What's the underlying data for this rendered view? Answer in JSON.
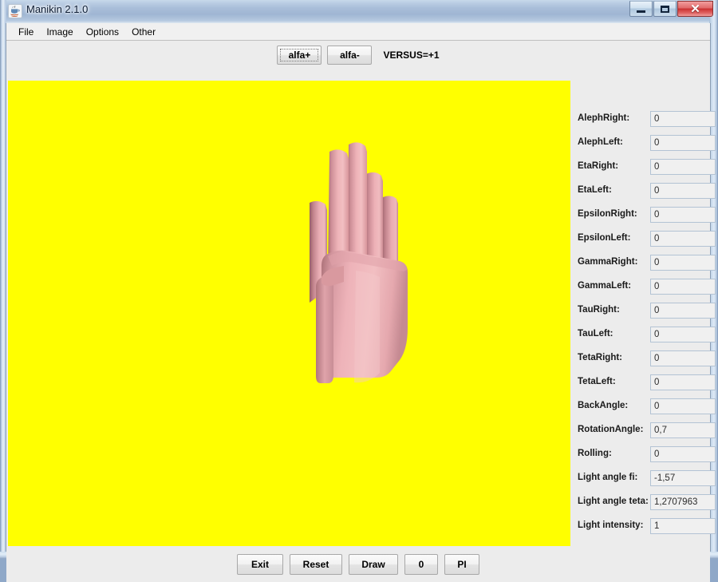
{
  "window": {
    "title": "Manikin 2.1.0",
    "icon": "java-coffee-cup-icon",
    "minimize_label": "Minimize",
    "maximize_label": "Maximize",
    "close_label": "✕"
  },
  "menu": {
    "items": [
      {
        "label": "File"
      },
      {
        "label": "Image"
      },
      {
        "label": "Options"
      },
      {
        "label": "Other"
      }
    ]
  },
  "toolbar": {
    "alfa_plus_label": "alfa+",
    "alfa_minus_label": "alfa-",
    "versus_label": "VERSUS=+1"
  },
  "canvas": {
    "background_color": "#ffff00",
    "object": "right-hand-3d-render",
    "skin_color": "#e8a2a8",
    "skin_highlight_color": "#f4c3c6",
    "skin_shadow_color": "#9e6268"
  },
  "parameters": [
    {
      "label": "AlephRight:",
      "value": "0"
    },
    {
      "label": "AlephLeft:",
      "value": "0"
    },
    {
      "label": "EtaRight:",
      "value": "0"
    },
    {
      "label": "EtaLeft:",
      "value": "0"
    },
    {
      "label": "EpsilonRight:",
      "value": "0"
    },
    {
      "label": "EpsilonLeft:",
      "value": "0"
    },
    {
      "label": "GammaRight:",
      "value": "0"
    },
    {
      "label": "GammaLeft:",
      "value": "0"
    },
    {
      "label": "TauRight:",
      "value": "0"
    },
    {
      "label": "TauLeft:",
      "value": "0"
    },
    {
      "label": "TetaRight:",
      "value": "0"
    },
    {
      "label": "TetaLeft:",
      "value": "0"
    },
    {
      "label": "BackAngle:",
      "value": "0"
    },
    {
      "label": "RotationAngle:",
      "value": "0,7"
    },
    {
      "label": "Rolling:",
      "value": "0"
    },
    {
      "label": "Light angle fi:",
      "value": "-1,57"
    },
    {
      "label": "Light angle teta:",
      "value": "1,2707963"
    },
    {
      "label": "Light intensity:",
      "value": "1"
    }
  ],
  "bottom_buttons": {
    "exit": "Exit",
    "reset": "Reset",
    "draw": "Draw",
    "zero": "0",
    "pi": "PI"
  }
}
